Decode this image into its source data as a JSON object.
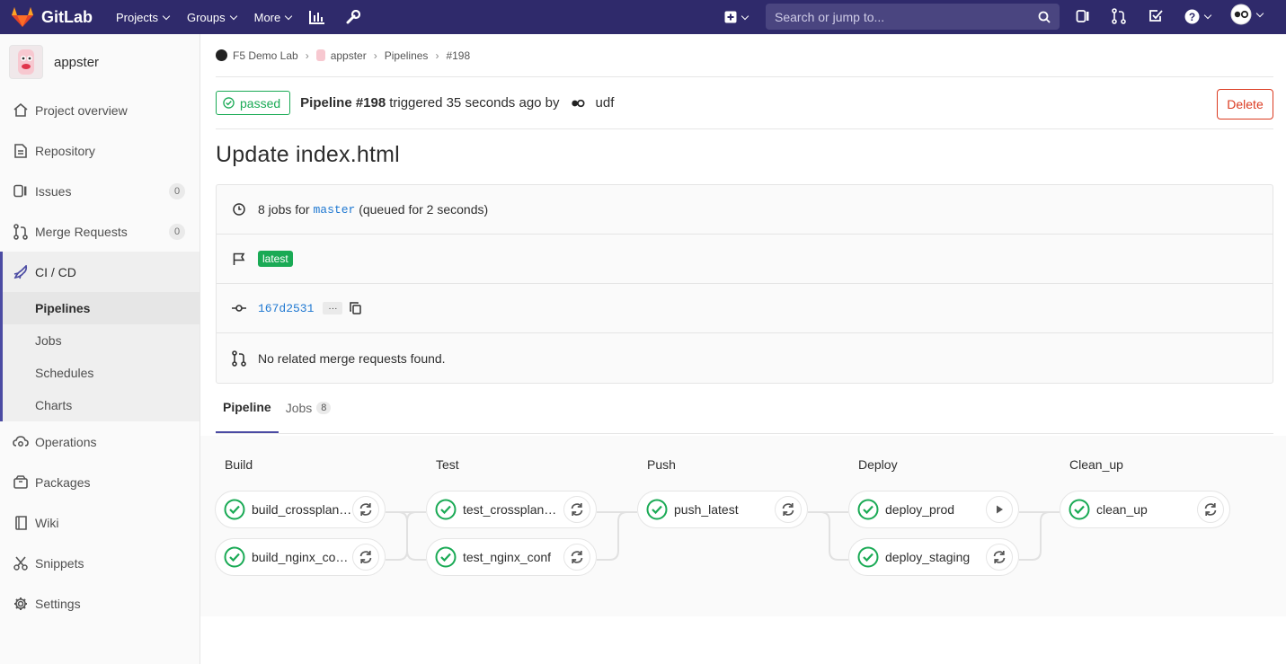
{
  "navbar": {
    "brand": "GitLab",
    "menus": [
      "Projects",
      "Groups",
      "More"
    ],
    "search_placeholder": "Search or jump to..."
  },
  "sidebar": {
    "project_name": "appster",
    "items": [
      {
        "label": "Project overview",
        "icon": "home-icon"
      },
      {
        "label": "Repository",
        "icon": "doc-icon"
      },
      {
        "label": "Issues",
        "icon": "issues-icon",
        "count": "0"
      },
      {
        "label": "Merge Requests",
        "icon": "merge-icon",
        "count": "0"
      },
      {
        "label": "CI / CD",
        "icon": "rocket-icon"
      }
    ],
    "cicd_sub": [
      "Pipelines",
      "Jobs",
      "Schedules",
      "Charts"
    ],
    "bottom_items": [
      {
        "label": "Operations",
        "icon": "cloud-gear-icon"
      },
      {
        "label": "Packages",
        "icon": "package-icon"
      },
      {
        "label": "Wiki",
        "icon": "book-icon"
      },
      {
        "label": "Snippets",
        "icon": "scissors-icon"
      },
      {
        "label": "Settings",
        "icon": "gear-icon"
      }
    ]
  },
  "breadcrumb": [
    "F5 Demo Lab",
    "appster",
    "Pipelines",
    "#198"
  ],
  "header": {
    "status": "passed",
    "pipeline_label": "Pipeline #198",
    "triggered_text": "triggered 35 seconds ago by",
    "user": "udf",
    "delete_label": "Delete"
  },
  "title": "Update index.html",
  "info": {
    "jobs_prefix": "8 jobs for",
    "branch": "master",
    "jobs_suffix": "(queued for 2 seconds)",
    "tag": "latest",
    "commit": "167d2531",
    "ellipsis": "···",
    "mr_text": "No related merge requests found."
  },
  "tabs": {
    "pipeline": "Pipeline",
    "jobs": "Jobs",
    "jobs_count": "8"
  },
  "stages": [
    {
      "name": "Build",
      "jobs": [
        {
          "name": "build_crossplane_nginx",
          "action": "retry"
        },
        {
          "name": "build_nginx_container",
          "action": "retry"
        }
      ]
    },
    {
      "name": "Test",
      "jobs": [
        {
          "name": "test_crossplane_nginx",
          "action": "retry"
        },
        {
          "name": "test_nginx_conf",
          "action": "retry"
        }
      ]
    },
    {
      "name": "Push",
      "jobs": [
        {
          "name": "push_latest",
          "action": "retry"
        }
      ]
    },
    {
      "name": "Deploy",
      "jobs": [
        {
          "name": "deploy_prod",
          "action": "play"
        },
        {
          "name": "deploy_staging",
          "action": "retry"
        }
      ]
    },
    {
      "name": "Clean_up",
      "jobs": [
        {
          "name": "clean_up",
          "action": "retry"
        }
      ]
    }
  ],
  "colors": {
    "navbar": "#2f2a6b",
    "success": "#1aaa55",
    "danger": "#db3b21",
    "link": "#1f78d1"
  }
}
